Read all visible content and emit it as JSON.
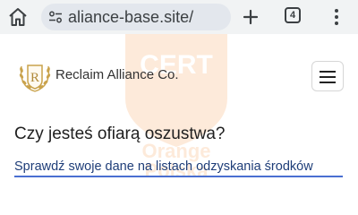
{
  "browser": {
    "url": "aliance-base.site/",
    "tab_count": "4",
    "icons": {
      "home": "home-icon",
      "site_info": "site-settings-icon",
      "new_tab": "plus-icon",
      "tab_switcher": "tab-count-icon",
      "menu": "more-vert-icon"
    }
  },
  "site": {
    "brand_name": "Reclaim Alliance Co.",
    "logo_letter": "R",
    "watermark_text": [
      "CERT",
      "Orange",
      "Polska"
    ],
    "colors": {
      "brand_text": "#333333",
      "link": "#1e3d78",
      "underline": "#4a6fd1",
      "watermark": "#f58220",
      "logo_gold": "#c9a24b"
    }
  },
  "hero": {
    "heading": "Czy jesteś ofiarą oszustwa?",
    "link_text": "Sprawdź swoje dane na listach odzyskania środków"
  }
}
